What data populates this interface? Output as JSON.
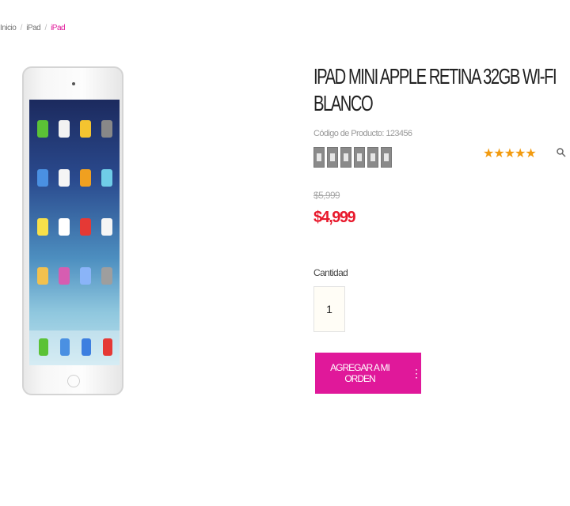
{
  "breadcrumb": {
    "items": [
      "Inicio",
      "/",
      "iPad",
      "/",
      "iPad"
    ]
  },
  "product": {
    "title": "IPAD MINI APPLE RETINA 32GB WI-FI BLANCO",
    "code": "Código de Producto: 123456",
    "rating": "★★★★★",
    "old_price": "$5,999",
    "new_price": "$4,999",
    "quantity_label": "Cantidad",
    "quantity_value": "1",
    "add_button_label": "AGREGAR A MI ORDEN",
    "thumbnail_count": 6
  },
  "colors": {
    "accent": "#e0189a",
    "price": "#e8192c",
    "rating": "#f29b10"
  },
  "icons": {
    "zoom": "zoom-icon",
    "more": "more-icon"
  }
}
